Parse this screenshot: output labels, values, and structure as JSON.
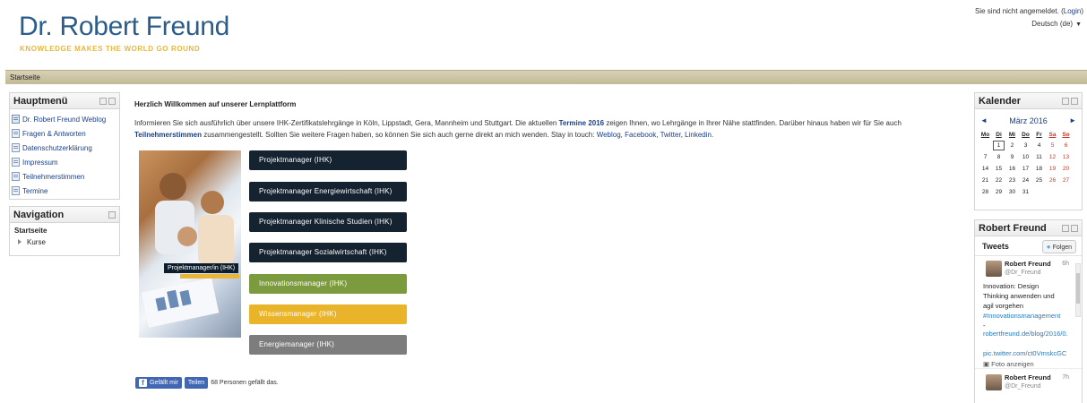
{
  "header": {
    "title": "Dr. Robert Freund",
    "tagline": "KNOWLEDGE MAKES THE WORLD GO ROUND",
    "login_text": "Sie sind nicht angemeldet. (",
    "login_link": "Login",
    "login_close": ")",
    "language": "Deutsch (de)"
  },
  "breadcrumb": {
    "home": "Startseite"
  },
  "main_menu": {
    "title": "Hauptmenü",
    "items": [
      {
        "label": "Dr. Robert Freund Weblog"
      },
      {
        "label": "Fragen & Antworten"
      },
      {
        "label": "Datenschutzerklärung"
      },
      {
        "label": "Impressum"
      },
      {
        "label": "Teilnehmerstimmen"
      },
      {
        "label": "Termine"
      }
    ]
  },
  "navigation": {
    "title": "Navigation",
    "home": "Startseite",
    "courses": "Kurse"
  },
  "main": {
    "title": "Herzlich Willkommen auf unserer Lernplattform",
    "intro": {
      "p1": "Informieren Sie sich ausführlich über unsere IHK-Zertifikatslehrgänge in Köln, Lippstadt, Gera, Mannheim und Stuttgart. Die aktuellen ",
      "link_termine": "Termine 2016",
      "p2": " zeigen Ihnen, wo Lehrgänge in Ihrer Nähe stattfinden. Darüber hinaus haben wir für Sie auch ",
      "link_teilnehmer": "Teilnehmerstimmen",
      "p3": " zusammengestellt. Sollten Sie weitere Fragen haben, so können Sie sich auch gerne direkt an mich wenden. Stay in touch: ",
      "link_weblog": "Weblog",
      "link_facebook": "Facebook",
      "link_twitter": "Twitter",
      "link_linkedin": "Linkedin",
      "sep": ", ",
      "end": "."
    },
    "photo_label": "Projektmanager/in (IHK)",
    "courses": [
      {
        "label": "Projektmanager (IHK)",
        "color": "#152230"
      },
      {
        "label": "Projektmanager Energiewirtschaft (IHK)",
        "color": "#152230"
      },
      {
        "label": "Projektmanager Klinische Studien (IHK)",
        "color": "#152230"
      },
      {
        "label": "Projektmanager Sozialwirtschaft (IHK)",
        "color": "#152230"
      },
      {
        "label": "Innovationsmanager (IHK)",
        "color": "#7c9a3e"
      },
      {
        "label": "Wissensmanager (IHK)",
        "color": "#eab42a"
      },
      {
        "label": "Energiemanager (IHK)",
        "color": "#7d7d7d"
      }
    ],
    "facebook": {
      "like": "Gefällt mir",
      "share": "Teilen",
      "count": "68 Personen gefällt das."
    }
  },
  "calendar": {
    "title": "Kalender",
    "prev": "◄",
    "next": "►",
    "month": "März 2016",
    "weekdays": [
      "Mo",
      "Di",
      "Mi",
      "Do",
      "Fr",
      "Sa",
      "So"
    ],
    "weeks": [
      [
        "",
        "1",
        "2",
        "3",
        "4",
        "5",
        "6"
      ],
      [
        "7",
        "8",
        "9",
        "10",
        "11",
        "12",
        "13"
      ],
      [
        "14",
        "15",
        "16",
        "17",
        "18",
        "19",
        "20"
      ],
      [
        "21",
        "22",
        "23",
        "24",
        "25",
        "26",
        "27"
      ],
      [
        "28",
        "29",
        "30",
        "31",
        "",
        "",
        ""
      ]
    ],
    "today": "1"
  },
  "twitter": {
    "block_title": "Robert Freund",
    "tweets_title": "Tweets",
    "follow": "Folgen",
    "tweet1": {
      "name": "Robert Freund",
      "handle": "@Dr_Freund",
      "time": "6h",
      "text": "Innovation: Design Thinking anwenden und agil vorgehen",
      "hashtag": "#Innovationsmanagement",
      "dash": "-",
      "link": "robertfreund.de/blog/2016/0...",
      "pic": "pic.twitter.com/ct0VmskcGC",
      "photo": "Foto anzeigen"
    },
    "tweet2": {
      "name": "Robert Freund",
      "handle": "@Dr_Freund",
      "time": "7h"
    }
  },
  "colors": {
    "brand_blue": "#2b5d8c",
    "tagline_gold": "#e8b63a",
    "link": "#1a3f8a",
    "breadcrumb_bar": "#c8bf9c"
  }
}
